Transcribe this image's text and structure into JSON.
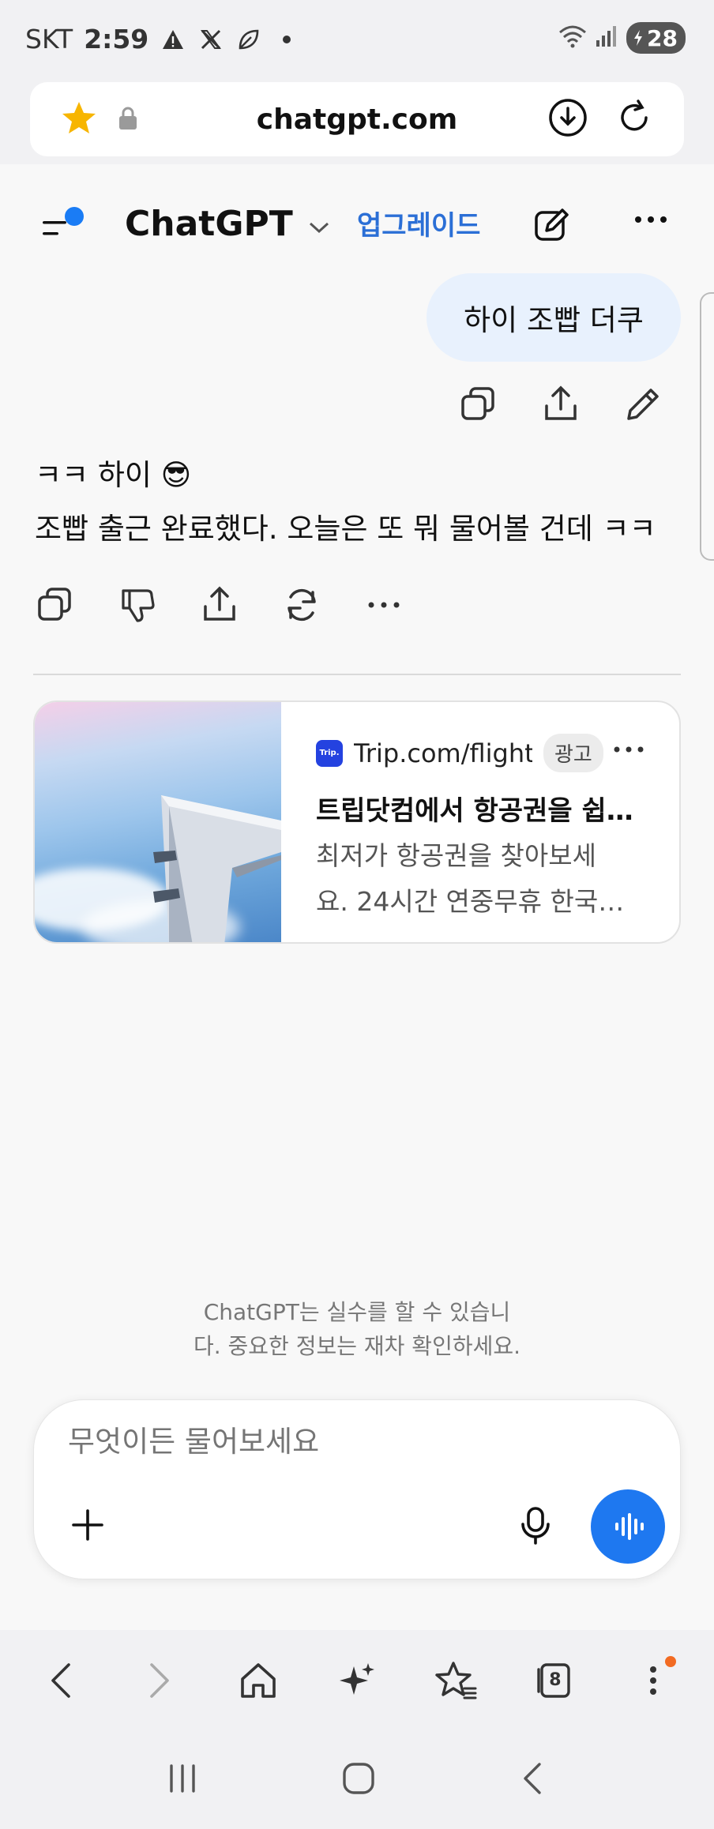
{
  "status_bar": {
    "carrier": "SKT",
    "time": "2:59",
    "battery": "28"
  },
  "browser": {
    "url": "chatgpt.com"
  },
  "header": {
    "title": "ChatGPT",
    "upgrade_label": "업그레이드"
  },
  "conversation": {
    "user_message": "하이 조빱 더쿠",
    "assistant_line1": "ㅋㅋ 하이 😎",
    "assistant_line2": "조빱 출근 완료했다. 오늘은 또 뭐 물어볼 건데 ㅋㅋ"
  },
  "ad": {
    "logo_text": "Trip.",
    "source": "Trip.com/flight",
    "badge": "광고",
    "title": "트립닷컴에서 항공권을 쉽게 예약하세요",
    "description_line1": "최저가 항공권을 찾아보세",
    "description_line2": "요. 24시간 연중무휴 한국…"
  },
  "disclaimer": {
    "line1": "ChatGPT는 실수를 할 수 있습니",
    "line2": "다. 중요한 정보는 재차 확인하세요."
  },
  "composer": {
    "placeholder": "무엇이든 물어보세요"
  },
  "browser_nav": {
    "tabs_count": "8"
  },
  "colors": {
    "accent": "#1e78f0",
    "user_bubble": "#e8f1fd",
    "upgrade_text": "#2b6fd6",
    "notification_dot": "#f26b22"
  },
  "icons": {
    "status": [
      "warning-icon",
      "x-icon",
      "leaf-icon",
      "dot-icon",
      "wifi-icon",
      "signal-icon",
      "battery-icon"
    ],
    "url_bar": [
      "star-icon",
      "lock-icon",
      "download-icon",
      "reload-icon"
    ],
    "user_actions": [
      "copy-icon",
      "share-icon",
      "edit-icon"
    ],
    "assistant_actions": [
      "copy-icon",
      "thumbs-down-icon",
      "share-icon",
      "regenerate-icon",
      "more-icon"
    ]
  }
}
